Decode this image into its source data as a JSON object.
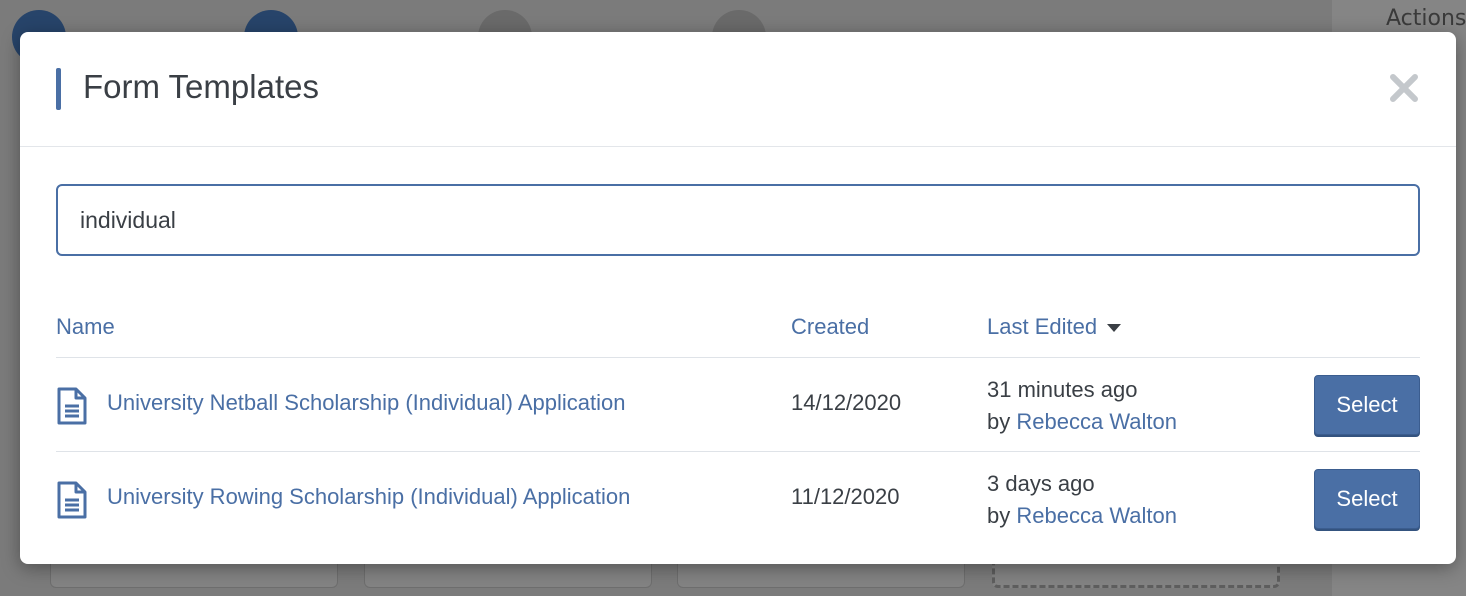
{
  "background": {
    "steps": [
      "",
      "",
      "",
      ""
    ],
    "actions_label": "Actions"
  },
  "modal": {
    "title": "Form Templates",
    "close_icon": "close-icon",
    "search": {
      "value": "individual",
      "placeholder": ""
    },
    "columns": {
      "name": "Name",
      "created": "Created",
      "last_edited": "Last Edited"
    },
    "rows": [
      {
        "icon": "document-icon",
        "name": "University Netball Scholarship (Individual) Application",
        "created": "14/12/2020",
        "edited_ago": "31 minutes ago",
        "by_prefix": "by",
        "by_name": "Rebecca Walton",
        "select_label": "Select"
      },
      {
        "icon": "document-icon",
        "name": "University Rowing Scholarship (Individual) Application",
        "created": "11/12/2020",
        "edited_ago": "3 days ago",
        "by_prefix": "by",
        "by_name": "Rebecca Walton",
        "select_label": "Select"
      }
    ]
  },
  "colors": {
    "accent": "#4a6fa5",
    "text": "#3a3f45",
    "overlay": "#7b7b7b"
  }
}
